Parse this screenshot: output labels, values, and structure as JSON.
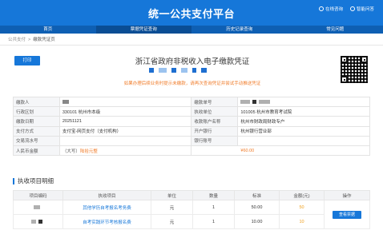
{
  "header": {
    "title": "统一公共支付平台",
    "links": [
      {
        "label": "在线咨询",
        "icon": "chat-icon"
      },
      {
        "label": "智能问答",
        "icon": "robot-icon"
      }
    ]
  },
  "nav": {
    "items": [
      "首页",
      "票据凭证查询",
      "历史记录查询",
      "常见问题"
    ],
    "active_index": 1
  },
  "breadcrumb": {
    "root": "公共支付",
    "sep": ">",
    "current": "缴款凭证页"
  },
  "print_label": "打印",
  "voucher": {
    "title": "浙江省政府非税收入电子缴款凭证",
    "warning": "如果办理后续业务时提示未缴款，请再次查询凭证并尝试手动推送凭证"
  },
  "info": {
    "rows": [
      {
        "l1": "缴款人",
        "v1": "",
        "l2": "缴款单号",
        "v2": ""
      },
      {
        "l1": "行政区划",
        "v1": "330101  杭州市本级",
        "l2": "执收单位",
        "v2": "101005  杭州市教育考试院"
      },
      {
        "l1": "缴款日期",
        "v1": "20251121",
        "l2": "收款账户名称",
        "v2": "杭州市财政局财政专户"
      },
      {
        "l1": "支付方式",
        "v1": "支付宝-网页支付（支付机构）",
        "l2": "开户银行",
        "v2": "杭州银行营业部"
      },
      {
        "l1": "交易流水号",
        "v1": "",
        "l2": "银行账号",
        "v2": ""
      }
    ],
    "amount_label": "人民币金额",
    "amount_upper_prefix": "（大写）",
    "amount_upper": "陆拾元整",
    "amount_lower": "¥60.00"
  },
  "items_section_title": "执收项目明细",
  "items": {
    "headers": [
      "项目编码",
      "执收项目",
      "单位",
      "数量",
      "标准",
      "金额(元)",
      "操作"
    ],
    "rows": [
      {
        "code": "",
        "name": "其他学历自考报名考务费",
        "unit": "元",
        "qty": "1",
        "std": "50.00",
        "amount": "50"
      },
      {
        "code": "",
        "name": "自考实践环节考核报名费",
        "unit": "元",
        "qty": "1",
        "std": "10.00",
        "amount": "10"
      }
    ],
    "action_label": "查看票据"
  },
  "colors": {
    "primary": "#1677d9",
    "nav": "#0e5fb3",
    "accent": "#f07c2a"
  }
}
